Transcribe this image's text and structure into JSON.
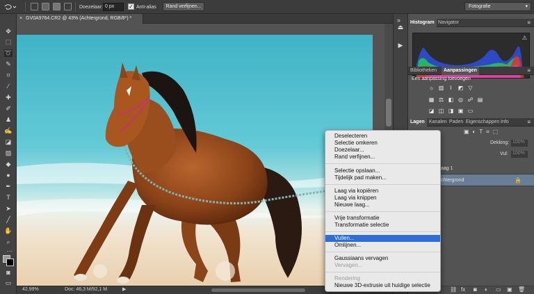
{
  "options_bar": {
    "feather_label": "Doezelaar:",
    "feather_value": "0 px",
    "antialias_label": "Anti-alias",
    "antialias_checked": true,
    "refine_edge_button": "Rand verfijnen...",
    "workspace_select": "Fotografie"
  },
  "document": {
    "tab_title": "GV0A9764.CR2 @ 43% (Achtergrond, RGB/8*) *"
  },
  "status_bar": {
    "zoom": "42,99%",
    "doc_size": "Doc: 46,3 M/92,1 M"
  },
  "panels": {
    "top_tabs": [
      "Histogram",
      "Navigator"
    ],
    "mid_tabs": [
      "Bibliotheken",
      "Aanpassingen"
    ],
    "adjustments_heading": "Een aanpassing toevoegen",
    "layers_tabs": [
      "Lagen",
      "Kanalen",
      "Paden",
      "Eigenschappen",
      "Info"
    ],
    "opacity_label": "Dekking:",
    "opacity_value": "100%",
    "fill_label": "Vul:",
    "fill_value": "100%",
    "layers": [
      {
        "name": "aag 1"
      },
      {
        "name": "chtergrond"
      }
    ]
  },
  "context_menu": {
    "groups": [
      [
        "Deselecteren",
        "Selectie omkeren",
        "Doezelaar...",
        "Rand verfijnen..."
      ],
      [
        "Selectie opslaan...",
        "Tijdelijk pad maken..."
      ],
      [
        "Laag via kopiëren",
        "Laag via knippen",
        "Nieuwe laag..."
      ],
      [
        "Vrije transformatie",
        "Transformatie selectie"
      ],
      [
        "Vullen...",
        "Omlijnen..."
      ],
      [
        "Gaussiaans vervagen",
        "Vervagen..."
      ],
      [
        "Rendering",
        "Nieuwe 3D-extrusie uit huidige selectie"
      ]
    ],
    "highlighted": "Vullen...",
    "disabled": [
      "Vervagen...",
      "Rendering"
    ]
  },
  "colors": {
    "menu_highlight": "#2f6cd6",
    "ui_dark": "#535353",
    "histogram_bg": "#2c2c2c"
  }
}
